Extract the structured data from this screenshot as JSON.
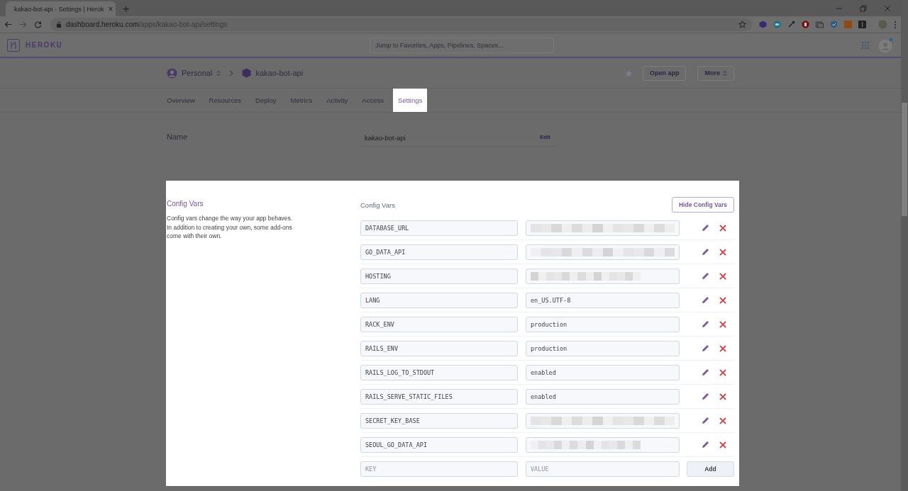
{
  "browser": {
    "tab_title": "kakao-bot-api · Settings | Herok",
    "tab_close": "×",
    "new_tab": "+",
    "url_host": "dashboard.heroku.com",
    "url_path": "/apps/kakao-bot-api/settings"
  },
  "header": {
    "logo": "HEROKU",
    "search": {
      "placeholder": "Jump to Favorites, Apps, Pipelines, Spaces..."
    }
  },
  "breadcrumb": {
    "account": "Personal",
    "app": "kakao-bot-api",
    "favorite": false,
    "buttons": [
      "Open app",
      "More"
    ]
  },
  "nav_tabs": [
    {
      "label": "Overview",
      "selected": false
    },
    {
      "label": "Resources",
      "selected": false
    },
    {
      "label": "Deploy",
      "selected": false
    },
    {
      "label": "Metrics",
      "selected": false
    },
    {
      "label": "Activity",
      "selected": false
    },
    {
      "label": "Access",
      "selected": false
    },
    {
      "label": "Settings",
      "selected": true
    }
  ],
  "name_row": {
    "label": "Name",
    "value": "kakao-bot-api",
    "action": "Edit"
  },
  "config_panel": {
    "title": "Config Vars",
    "description": "Config vars change the way your app behaves. In addition to creating your own, some add-ons come with their own.",
    "heading": "Config Vars",
    "toggle_button": "Hide Config Vars",
    "vars": [
      {
        "key": "DATABASE_URL",
        "redacted": true
      },
      {
        "key": "GO_DATA_API",
        "redacted": true
      },
      {
        "key": "HOSTING",
        "redacted": true
      },
      {
        "key": "LANG",
        "redacted": false,
        "value": "en_US.UTF-8"
      },
      {
        "key": "RACK_ENV",
        "redacted": false,
        "value": "production"
      },
      {
        "key": "RAILS_ENV",
        "redacted": false,
        "value": "production"
      },
      {
        "key": "RAILS_LOG_TO_STDOUT",
        "redacted": false,
        "value": "enabled"
      },
      {
        "key": "RAILS_SERVE_STATIC_FILES",
        "redacted": false,
        "value": "enabled"
      },
      {
        "key": "SECRET_KEY_BASE",
        "redacted": true
      },
      {
        "key": "SEOUL_GO_DATA_API",
        "redacted": true
      }
    ],
    "new_var": {
      "key_placeholder": "KEY",
      "value_placeholder": "VALUE",
      "button": "Add"
    }
  }
}
